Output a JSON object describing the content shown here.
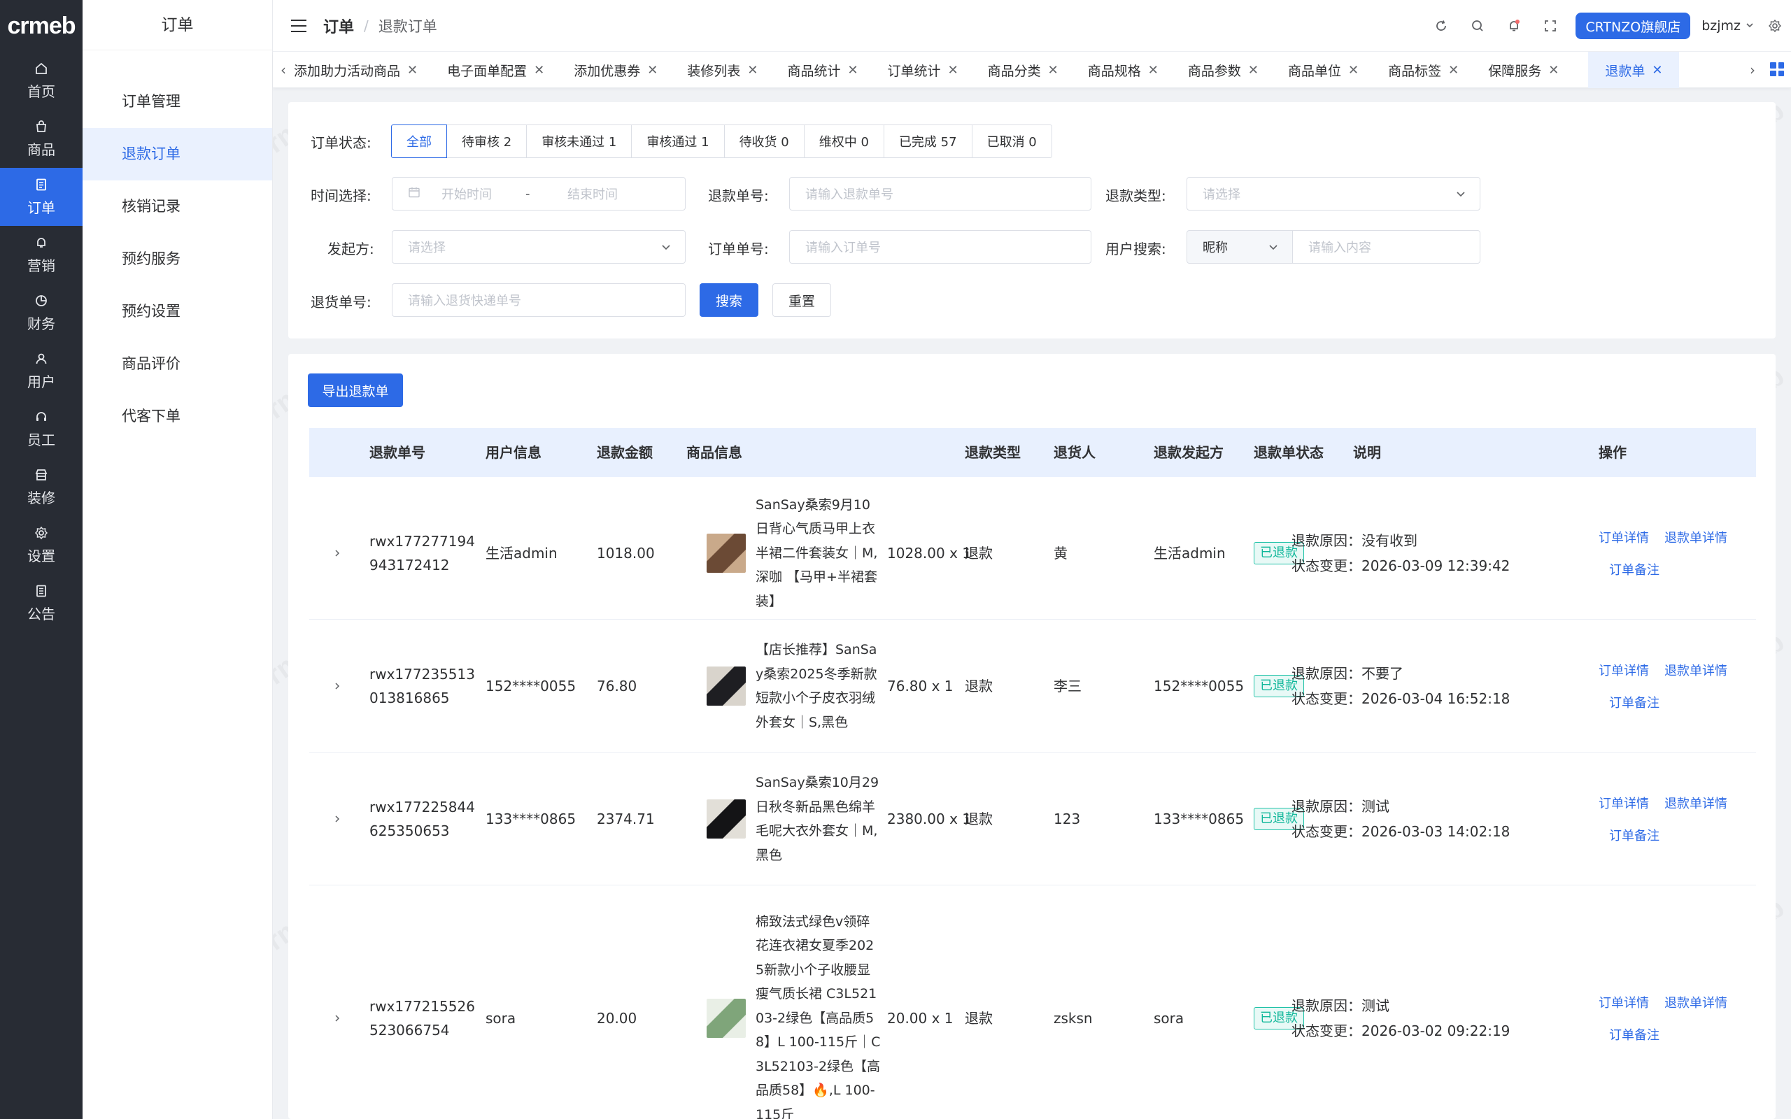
{
  "brand": {
    "logo": "crmeb"
  },
  "rail": [
    {
      "label": "首页",
      "icon": "home-icon"
    },
    {
      "label": "商品",
      "icon": "bag-icon"
    },
    {
      "label": "订单",
      "icon": "document-icon"
    },
    {
      "label": "营销",
      "icon": "bell-icon"
    },
    {
      "label": "财务",
      "icon": "pie-chart-icon"
    },
    {
      "label": "用户",
      "icon": "user-icon"
    },
    {
      "label": "员工",
      "icon": "headset-icon"
    },
    {
      "label": "装修",
      "icon": "store-icon"
    },
    {
      "label": "设置",
      "icon": "gear-icon"
    },
    {
      "label": "公告",
      "icon": "notice-icon"
    }
  ],
  "submenu": {
    "title": "订单",
    "items": [
      "订单管理",
      "退款订单",
      "核销记录",
      "预约服务",
      "预约设置",
      "商品评价",
      "代客下单"
    ]
  },
  "header": {
    "crumb_main": "订单",
    "crumb_sep": "/",
    "crumb_sub": "退款订单",
    "shop_button": "CRTNZO旗舰店",
    "user": "bzjmz"
  },
  "tags": [
    "添加助力活动商品",
    "电子面单配置",
    "添加优惠券",
    "装修列表",
    "商品统计",
    "订单统计",
    "商品分类",
    "商品规格",
    "商品参数",
    "商品单位",
    "商品标签",
    "保障服务",
    "退款单"
  ],
  "filters": {
    "status_label": "订单状态:",
    "status_tabs": [
      "全部",
      "待审核 2",
      "审核未通过 1",
      "审核通过 1",
      "待收货 0",
      "维权中 0",
      "已完成 57",
      "已取消 0"
    ],
    "time_label": "时间选择:",
    "time_start": "开始时间",
    "time_dash": "-",
    "time_end": "结束时间",
    "refund_no_label": "退款单号:",
    "refund_no_ph": "请输入退款单号",
    "refund_type_label": "退款类型:",
    "refund_type_ph": "请选择",
    "initiator_label": "发起方:",
    "initiator_ph": "请选择",
    "order_no_label": "订单单号:",
    "order_no_ph": "请输入订单号",
    "user_search_label": "用户搜索:",
    "user_search_field": "昵称",
    "user_search_ph": "请输入内容",
    "return_no_label": "退货单号:",
    "return_no_ph": "请输入退货快递单号",
    "search_btn": "搜索",
    "reset_btn": "重置"
  },
  "export_btn": "导出退款单",
  "table": {
    "headers": [
      "退款单号",
      "用户信息",
      "退款金额",
      "商品信息",
      "退款类型",
      "退货人",
      "退款发起方",
      "退款单状态",
      "说明",
      "操作"
    ],
    "ops": [
      "订单详情",
      "退款单详情",
      "订单备注"
    ],
    "rows": [
      {
        "refund_no_1": "rwx177277194",
        "refund_no_2": "943172412",
        "user": "生活admin",
        "amount": "1018.00",
        "product": "SanSay桑索9月10日背心气质马甲上衣半裙二件套装女｜M,深咖 【马甲+半裙套装】",
        "price_qty": "1028.00 x 1",
        "type": "退款",
        "returner": "黄",
        "initiator": "生活admin",
        "status": "已退款",
        "reason": "退款原因：没有收到",
        "changed": "状态变更：2026-03-09 12:39:42"
      },
      {
        "refund_no_1": "rwx177235513",
        "refund_no_2": "013816865",
        "user": "152****0055",
        "amount": "76.80",
        "product": "【店长推荐】SanSay桑索2025冬季新款短款小个子皮衣羽绒外套女｜S,黑色",
        "price_qty": "76.80 x 1",
        "type": "退款",
        "returner": "李三",
        "initiator": "152****0055",
        "status": "已退款",
        "reason": "退款原因：不要了",
        "changed": "状态变更：2026-03-04 16:52:18"
      },
      {
        "refund_no_1": "rwx177225844",
        "refund_no_2": "625350653",
        "user": "133****0865",
        "amount": "2374.71",
        "product": "SanSay桑索10月29日秋冬新品黑色绵羊毛呢大衣外套女｜M,黑色",
        "price_qty": "2380.00 x 1",
        "type": "退款",
        "returner": "123",
        "initiator": "133****0865",
        "status": "已退款",
        "reason": "退款原因：测试",
        "changed": "状态变更：2026-03-03 14:02:18"
      },
      {
        "refund_no_1": "rwx177215526",
        "refund_no_2": "523066754",
        "user": "sora",
        "amount": "20.00",
        "product": "棉致法式绿色v领碎花连衣裙女夏季2025新款小个子收腰显瘦气质长裙 C3L52103-2绿色【高品质58】L 100-115斤｜C3L52103-2绿色【高品质58】🔥,L 100-115斤",
        "price_qty": "20.00 x 1",
        "type": "退款",
        "returner": "zsksn",
        "initiator": "sora",
        "status": "已退款",
        "reason": "退款原因：测试",
        "changed": "状态变更：2026-03-02 09:22:19"
      }
    ]
  },
  "colors": {
    "primary": "#2d6ae6",
    "rail_bg": "#282c34",
    "success": "#10b79a"
  }
}
